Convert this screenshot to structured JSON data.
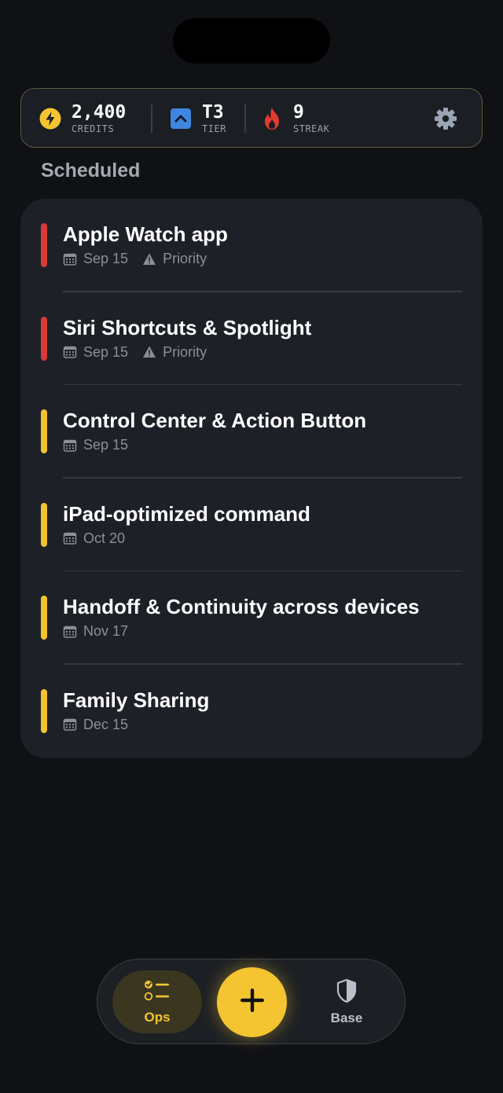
{
  "stats": {
    "credits": {
      "value": "2,400",
      "label": "CREDITS",
      "icon": "lightning-icon"
    },
    "tier": {
      "value": "T3",
      "label": "TIER",
      "icon": "chevron-up-icon"
    },
    "streak": {
      "value": "9",
      "label": "STREAK",
      "icon": "flame-icon"
    },
    "settings_icon": "gear-icon"
  },
  "section_title": "Scheduled",
  "tasks": [
    {
      "title": "Apple Watch app",
      "date": "Sep 15",
      "tag": "Priority",
      "priority_color": "#d93a36"
    },
    {
      "title": "Siri Shortcuts & Spotlight",
      "date": "Sep 15",
      "tag": "Priority",
      "priority_color": "#d93a36"
    },
    {
      "title": "Control Center & Action Button",
      "date": "Sep 15",
      "tag": "",
      "priority_color": "#f2c230"
    },
    {
      "title": "iPad-optimized command",
      "date": "Oct 20",
      "tag": "",
      "priority_color": "#f2c230"
    },
    {
      "title": "Handoff & Continuity across devices",
      "date": "Nov 17",
      "tag": "",
      "priority_color": "#f2c230"
    },
    {
      "title": "Family Sharing",
      "date": "Dec 15",
      "tag": "",
      "priority_color": "#f2c230"
    }
  ],
  "nav": {
    "ops_label": "Ops",
    "base_label": "Base",
    "add_icon": "plus-icon"
  },
  "colors": {
    "accent": "#f5c531",
    "background": "#0f1115",
    "card": "#1d2027"
  }
}
